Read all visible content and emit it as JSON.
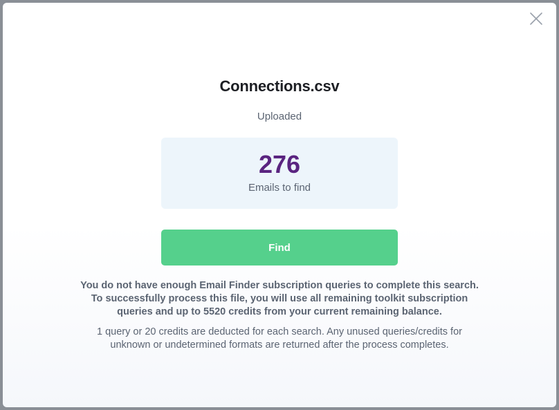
{
  "modal": {
    "title": "Connections.csv",
    "subtitle": "Uploaded",
    "close_icon": "close-icon",
    "stat": {
      "number": "276",
      "label": "Emails to find"
    },
    "find_button": "Find",
    "warning_lines": [
      "You do not have enough Email Finder subscription queries to complete this search.",
      "To successfully process this file, you will use all remaining toolkit subscription",
      "queries and up to 5520 credits from your current remaining balance."
    ],
    "note_lines": [
      "1 query or 20 credits are deducted for each search. Any unused queries/credits for",
      "unknown or undetermined formats are returned after the process completes."
    ]
  },
  "colors": {
    "accent_green": "#55d08c",
    "stat_purple": "#5a2480",
    "card_bg": "#edf5fb",
    "text_muted": "#5b6472"
  }
}
